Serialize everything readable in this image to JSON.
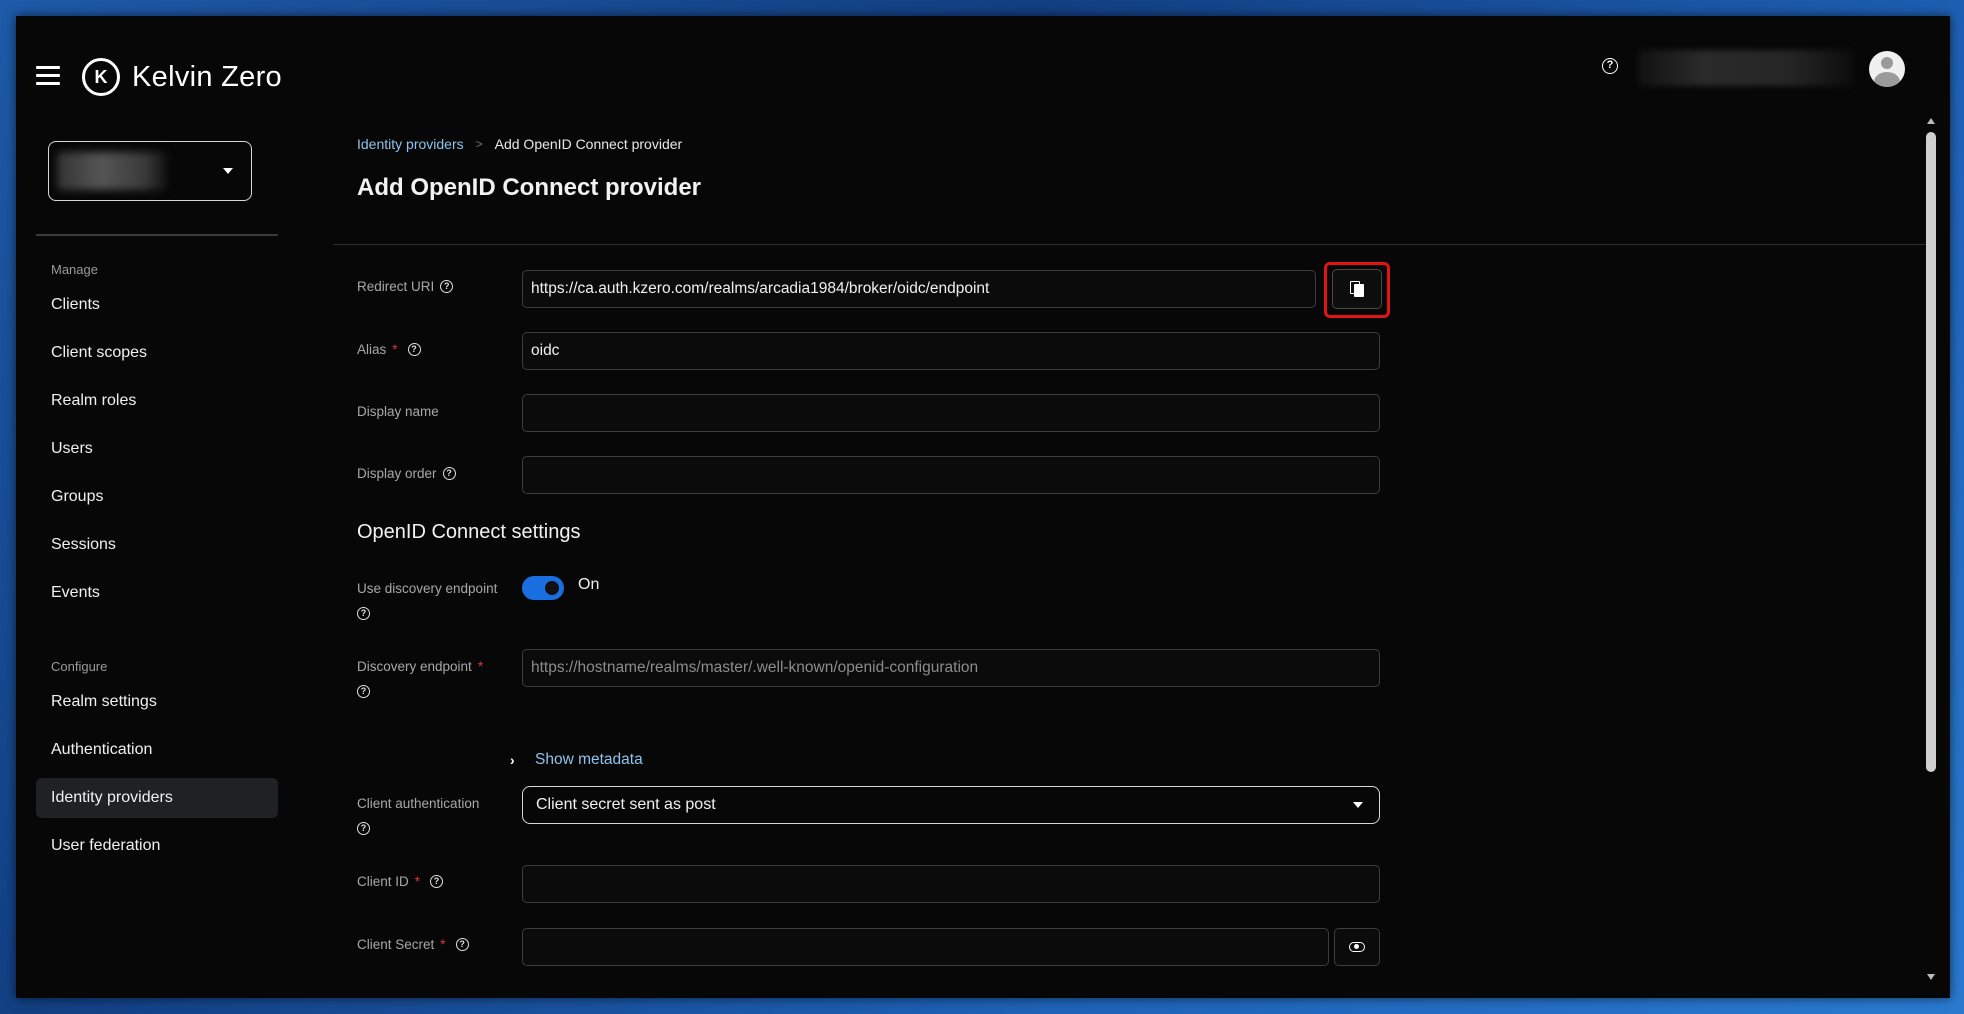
{
  "app": {
    "title": "Kelvin Zero"
  },
  "header": {
    "help_icon": "help-icon",
    "avatar_icon": "user-avatar-icon"
  },
  "sidebar": {
    "sections": [
      {
        "label": "Manage",
        "items": [
          "Clients",
          "Client scopes",
          "Realm roles",
          "Users",
          "Groups",
          "Sessions",
          "Events"
        ]
      },
      {
        "label": "Configure",
        "items": [
          "Realm settings",
          "Authentication",
          "Identity providers",
          "User federation"
        ]
      }
    ],
    "active_item": "Identity providers"
  },
  "breadcrumb": {
    "parent": "Identity providers",
    "current": "Add OpenID Connect provider"
  },
  "page": {
    "title": "Add OpenID Connect provider"
  },
  "form": {
    "redirect_uri": {
      "label": "Redirect URI",
      "value": "https://ca.auth.kzero.com/realms/arcadia1984/broker/oidc/endpoint"
    },
    "alias": {
      "label": "Alias",
      "required": "*",
      "value": "oidc"
    },
    "display_name": {
      "label": "Display name",
      "value": ""
    },
    "display_order": {
      "label": "Display order",
      "value": ""
    },
    "section_title": "OpenID Connect settings",
    "use_discovery": {
      "label": "Use discovery endpoint",
      "state": "On"
    },
    "discovery_endpoint": {
      "label": "Discovery endpoint",
      "required": "*",
      "placeholder": "https://hostname/realms/master/.well-known/openid-configuration"
    },
    "show_metadata": "Show metadata",
    "client_auth": {
      "label": "Client authentication",
      "value": "Client secret sent as post"
    },
    "client_id": {
      "label": "Client ID",
      "required": "*",
      "value": ""
    },
    "client_secret": {
      "label": "Client Secret",
      "required": "*",
      "value": ""
    }
  },
  "colors": {
    "accent": "#1a6fe0",
    "link": "#8fc2ee",
    "required": "#e0343f",
    "highlight": "#e01414"
  }
}
